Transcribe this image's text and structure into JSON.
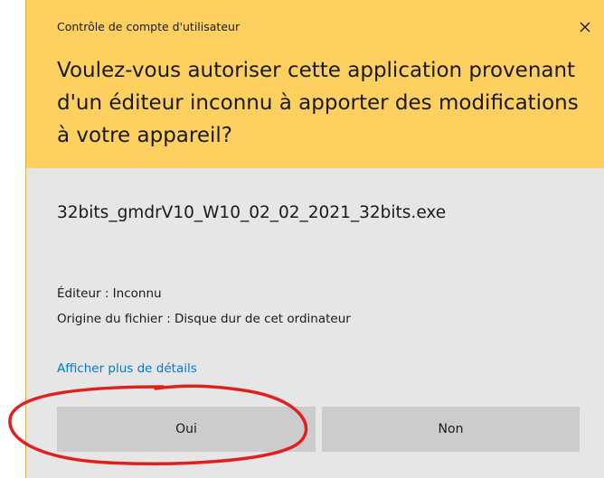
{
  "dialog": {
    "title": "Contrôle de compte d'utilisateur",
    "close_icon": "close-icon",
    "headline": "Voulez-vous autoriser cette application provenant d'un éditeur inconnu à apporter des modifications à votre appareil?",
    "filename": "32bits_gmdrV10_W10_02_02_2021_32bits.exe",
    "publisher": "Éditeur : Inconnu",
    "origin": "Origine du fichier : Disque dur de cet ordinateur",
    "details_link": "Afficher plus de détails",
    "yes_label": "Oui",
    "no_label": "Non"
  },
  "colors": {
    "header": "#fdd05f",
    "body": "#e6e6e6",
    "button": "#cccccc",
    "link": "#0078d7",
    "annotation": "#e0201c"
  }
}
